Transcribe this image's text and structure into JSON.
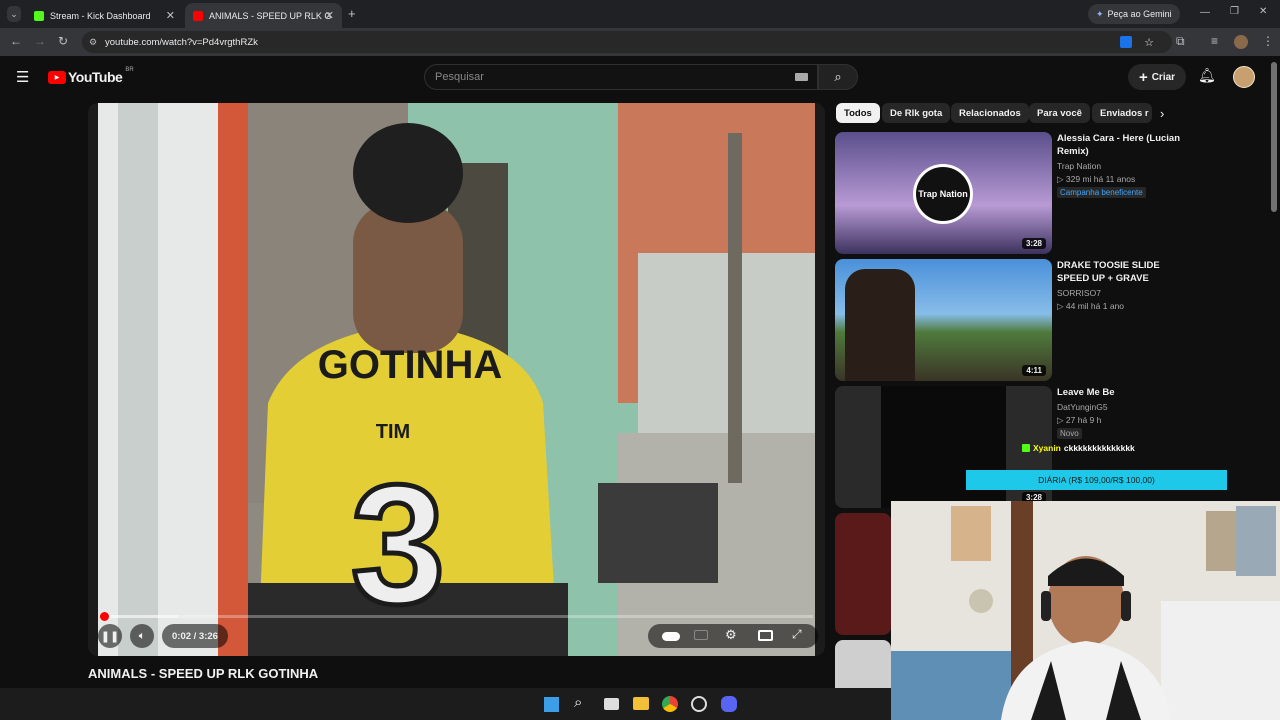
{
  "browser": {
    "tabs": [
      {
        "title": "Stream - Kick Dashboard",
        "color": "#53fc18"
      },
      {
        "title": "ANIMALS - SPEED UP RLK G",
        "color": "#ff0000"
      }
    ],
    "gemini_label": "Peça ao Gemini",
    "url": "youtube.com/watch?v=Pd4vrgthRZk"
  },
  "youtube": {
    "logo": "YouTube",
    "region": "BR",
    "search_placeholder": "Pesquisar",
    "create_label": "Criar"
  },
  "player": {
    "time": "0:02 / 3:26",
    "progress": 0.01,
    "jersey_name": "GOTINHA",
    "jersey_sponsor": "TIM",
    "jersey_number": "3"
  },
  "video_title": "ANIMALS - SPEED UP RLK GOTINHA",
  "chips": [
    "Todos",
    "De Rlk gota",
    "Relacionados",
    "Para você",
    "Enviados r"
  ],
  "recommendations": [
    {
      "title": "Alessia Cara - Here (Lucian Remix)",
      "channel": "Trap Nation",
      "meta": "▷ 329 mi  há 11 anos",
      "badge": "Campanha beneficente",
      "duration": "3:28",
      "thumb_text": "Trap Nation"
    },
    {
      "title": "DRAKE TOOSIE SLIDE SPEED UP + GRAVE",
      "channel": "SORRISO7",
      "meta": "▷ 44 mil  há 1 ano",
      "duration": "4:11"
    },
    {
      "title": "Leave Me Be",
      "channel": "DatYunginG5",
      "meta": "▷ 27  há 9 h",
      "badge": "Novo",
      "duration": "3:28"
    }
  ],
  "overlay": {
    "chat_user": "Xyanin",
    "chat_msg": "ckkkkkkkkkkkkkk",
    "banner": "DIÁRIA (R$ 109,00/R$ 100,00)"
  }
}
